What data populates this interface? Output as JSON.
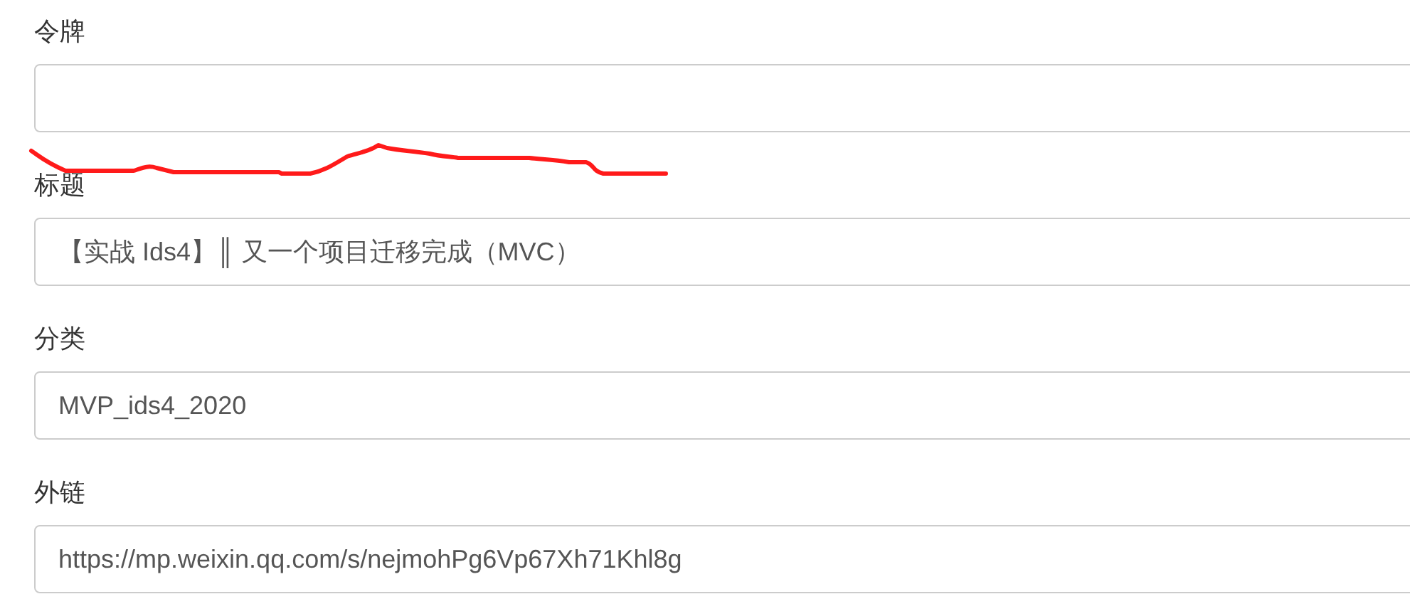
{
  "fields": [
    {
      "label": "令牌"
    },
    {
      "label": "标题",
      "value": "【实战 Ids4】║ 又一个项目迁移完成（MVC）"
    },
    {
      "label": "分类",
      "value": "MVP_ids4_2020"
    },
    {
      "label": "外链",
      "value": "https://mp.weixin.qq.com/s/nejmohPg6Vp67Xh71Khl8g"
    }
  ],
  "annotation": {
    "kind": "scribble"
  }
}
